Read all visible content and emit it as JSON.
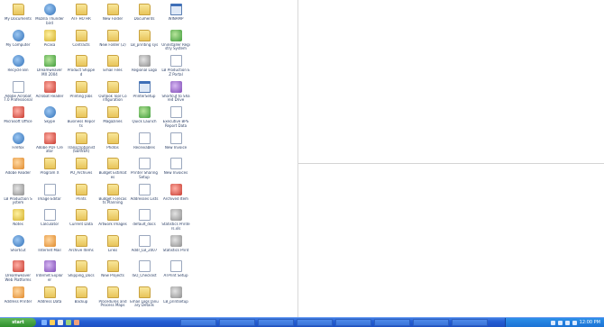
{
  "desktop": {
    "icons": [
      {
        "label": "My Documents",
        "icon": "folder"
      },
      {
        "label": "Mozilla Thunderbird",
        "icon": "app-blue"
      },
      {
        "label": "ATF HO HR",
        "icon": "folder"
      },
      {
        "label": "New Folder",
        "icon": "folder"
      },
      {
        "label": "Documents",
        "icon": "folder"
      },
      {
        "label": "WINAMP",
        "icon": "window"
      },
      {
        "label": "My Computer",
        "icon": "app-blue"
      },
      {
        "label": "Picasa",
        "icon": "app-yellow"
      },
      {
        "label": "Contracts",
        "icon": "folder"
      },
      {
        "label": "New Folder (2)",
        "icon": "folder"
      },
      {
        "label": "LB_printing sys",
        "icon": "folder"
      },
      {
        "label": "Uninstaller Registry System",
        "icon": "app-green"
      },
      {
        "label": "Recycle Bin",
        "icon": "app-blue"
      },
      {
        "label": "Dreamweaver MX 2004",
        "icon": "app-green"
      },
      {
        "label": "Product Shipped",
        "icon": "folder"
      },
      {
        "label": "Email Files",
        "icon": "folder"
      },
      {
        "label": "Regional Logo",
        "icon": "app-gray"
      },
      {
        "label": "LB Production EZ Portal",
        "icon": "doc"
      },
      {
        "label": "Adobe Acrobat 7.0 Professional",
        "icon": "doc"
      },
      {
        "label": "Acrobat Reader",
        "icon": "app-red"
      },
      {
        "label": "Printing Jobs",
        "icon": "folder"
      },
      {
        "label": "Outlook Tool Configuration",
        "icon": "folder"
      },
      {
        "label": "PrinterSetup",
        "icon": "window"
      },
      {
        "label": "Shortcut to Shared Drive",
        "icon": "app-purple"
      },
      {
        "label": "Microsoft Office",
        "icon": "app-red"
      },
      {
        "label": "Skype",
        "icon": "app-blue"
      },
      {
        "label": "Business Reports",
        "icon": "folder"
      },
      {
        "label": "Magazines",
        "icon": "folder"
      },
      {
        "label": "Quick Launch",
        "icon": "app-green"
      },
      {
        "label": "Executive BPS Report Data",
        "icon": "doc"
      },
      {
        "label": "Firefox",
        "icon": "app-blue"
      },
      {
        "label": "Adobe PDF Creator",
        "icon": "app-red"
      },
      {
        "label": "Transcriptionist (SERVER)",
        "icon": "folder"
      },
      {
        "label": "Photos",
        "icon": "folder"
      },
      {
        "label": "Receivables",
        "icon": "doc"
      },
      {
        "label": "New Invoice",
        "icon": "doc"
      },
      {
        "label": "Adobe Reader",
        "icon": "app-orange"
      },
      {
        "label": "Program X",
        "icon": "folder"
      },
      {
        "label": "PO_Archives",
        "icon": "folder"
      },
      {
        "label": "Budget Estimates",
        "icon": "folder"
      },
      {
        "label": "Printer Sharing Setup",
        "icon": "doc"
      },
      {
        "label": "New Invoices",
        "icon": "doc"
      },
      {
        "label": "LB Production System",
        "icon": "app-gray"
      },
      {
        "label": "Image Editor",
        "icon": "doc"
      },
      {
        "label": "Prints",
        "icon": "folder"
      },
      {
        "label": "Budget Forecasts Planning",
        "icon": "folder"
      },
      {
        "label": "Addresses Lists",
        "icon": "doc"
      },
      {
        "label": "Archived Item",
        "icon": "app-red"
      },
      {
        "label": "Notes",
        "icon": "app-yellow"
      },
      {
        "label": "Calculator",
        "icon": "doc"
      },
      {
        "label": "Current Data",
        "icon": "folder"
      },
      {
        "label": "Artwork Images",
        "icon": "folder"
      },
      {
        "label": "default_docs",
        "icon": "doc"
      },
      {
        "label": "Statistics Printers.xls",
        "icon": "app-gray"
      },
      {
        "label": "Shortcut",
        "icon": "app-blue"
      },
      {
        "label": "Internet Mail",
        "icon": "app-orange"
      },
      {
        "label": "Archive Items",
        "icon": "folder"
      },
      {
        "label": "Links",
        "icon": "folder"
      },
      {
        "label": "Addr_LB_2007",
        "icon": "doc"
      },
      {
        "label": "Statistics Print",
        "icon": "app-gray"
      },
      {
        "label": "Dreamweaver Web Platforms",
        "icon": "app-red"
      },
      {
        "label": "Internet Explorer",
        "icon": "app-purple"
      },
      {
        "label": "Shipping_Docs",
        "icon": "folder"
      },
      {
        "label": "New Projects",
        "icon": "folder"
      },
      {
        "label": "ISO_Checklist",
        "icon": "doc"
      },
      {
        "label": "ATPrint Setup",
        "icon": "doc"
      },
      {
        "label": "Address Printer",
        "icon": "app-orange"
      },
      {
        "label": "Address Data",
        "icon": "folder"
      },
      {
        "label": "Backup",
        "icon": "folder"
      },
      {
        "label": "Procedures and Process Maps",
        "icon": "folder"
      },
      {
        "label": "Email Logs January Details",
        "icon": "folder"
      },
      {
        "label": "LB_printsetup",
        "icon": "app-gray"
      }
    ]
  },
  "taskbar": {
    "start_label": "start",
    "clock": "12:00 PM",
    "task_count": 8
  },
  "colors": {
    "taskbar": "#245dd3",
    "start": "#2f8f2c",
    "tray": "#1b72d4"
  }
}
